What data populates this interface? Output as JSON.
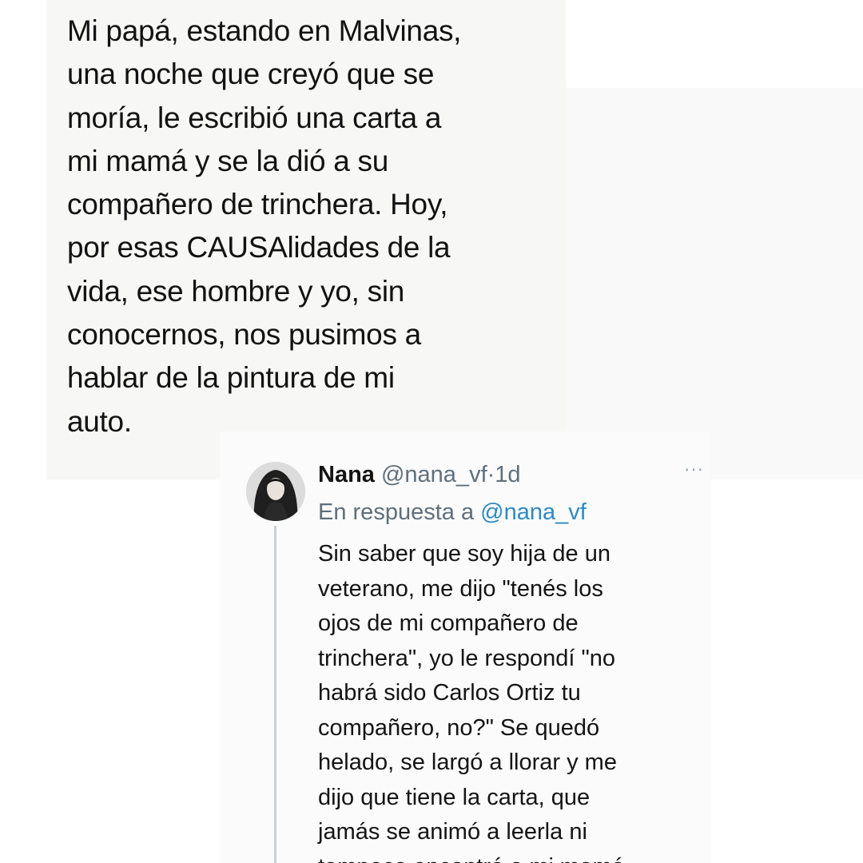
{
  "main_tweet": {
    "lines": [
      "Mi papá, estando en Malvinas,",
      "una noche que creyó que se",
      "moría, le escribió una carta a",
      "mi mamá y se la dió a su",
      "compañero de trinchera. Hoy,",
      "por esas CAUSAlidades de la",
      "vida, ese hombre y yo, sin",
      "conocernos, nos pusimos a",
      "hablar de la pintura de mi",
      "auto."
    ]
  },
  "reply": {
    "name": "Nana",
    "handle": "@nana_vf",
    "separator": "·",
    "time": "1d",
    "more_icon": "more-horizontal-icon",
    "context_prefix": "En respuesta a ",
    "context_mention": "@nana_vf",
    "lines": [
      "Sin saber que soy hija de un",
      "veterano, me dijo \"tenés los",
      "ojos de mi compañero de",
      "trinchera\", yo le respondí \"no",
      "habrá sido Carlos Ortiz tu",
      "compañero, no?\" Se quedó",
      "helado, se largó a llorar y me",
      "dijo que tiene la carta, que",
      "jamás se animó a leerla ni",
      "tampoco encontró a mi mamá"
    ]
  },
  "colors": {
    "text": "#141414",
    "secondary": "#5f6f7c",
    "link": "#2d8ac4",
    "thread_line": "#c9d0d6"
  }
}
